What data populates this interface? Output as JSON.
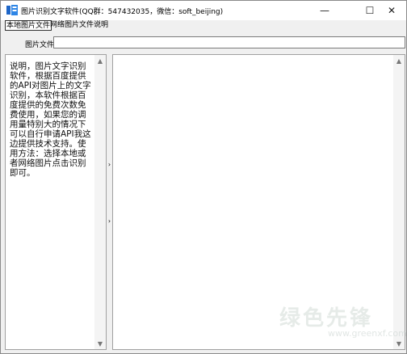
{
  "window": {
    "title": "图片识别文字软件(QQ群：547432035，微信：soft_beijing)",
    "controls": {
      "minimize": "—",
      "maximize": "☐",
      "close": "✕"
    }
  },
  "menu": {
    "items": [
      {
        "label": "本地图片文件"
      },
      {
        "label": "网络图片文件"
      },
      {
        "label": "说明"
      }
    ]
  },
  "file": {
    "label": "图片文件",
    "value": ""
  },
  "description": {
    "text": "说明，图片文字识别软件，根据百度提供的API对图片上的文字识别，本软件根据百度提供的免费次数免费使用，如果您的调用量特别大的情况下可以自行申请API我这边提供技术支持。使用方法：选择本地或者网络图片点击识别即可。"
  },
  "result": {
    "text": ""
  },
  "scroll": {
    "up": "▲",
    "down": "▼"
  },
  "splitter": {
    "arrow": "›"
  },
  "watermark": {
    "main": "绿色先锋",
    "sub": "www.greenxf.com"
  },
  "colors": {
    "border": "#a0a0a0",
    "background": "#f0f0f0",
    "pane": "#ffffff"
  }
}
